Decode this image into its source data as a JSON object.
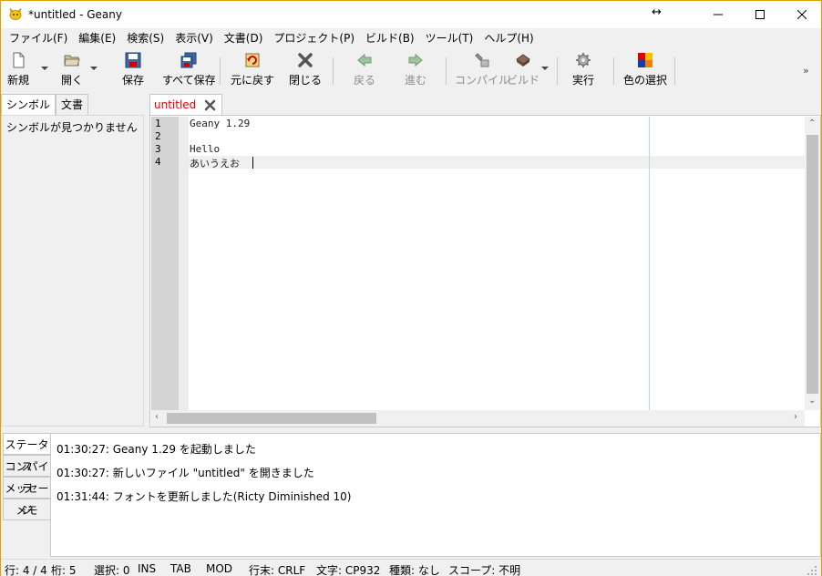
{
  "window": {
    "title": "*untitled - Geany",
    "resize_hint": "↔"
  },
  "menu": [
    {
      "label": "ファイル(F)"
    },
    {
      "label": "編集(E)"
    },
    {
      "label": "検索(S)"
    },
    {
      "label": "表示(V)"
    },
    {
      "label": "文書(D)"
    },
    {
      "label": "プロジェクト(P)"
    },
    {
      "label": "ビルド(B)"
    },
    {
      "label": "ツール(T)"
    },
    {
      "label": "ヘルプ(H)"
    }
  ],
  "toolbar": {
    "new_label": "新規",
    "open_label": "開く",
    "save_label": "保存",
    "save_all_label": "すべて保存",
    "revert_label": "元に戻す",
    "close_label": "閉じる",
    "back_label": "戻る",
    "forward_label": "進む",
    "compile_label": "コンパイル",
    "build_label": "ビルド",
    "run_label": "実行",
    "color_label": "色の選択",
    "more_label": "»"
  },
  "sidebar": {
    "tabs": [
      {
        "label": "シンボル"
      },
      {
        "label": "文書"
      }
    ],
    "empty_message": "シンボルが見つかりません"
  },
  "document_tab": {
    "label": "untitled"
  },
  "editor": {
    "lines": [
      {
        "number": "1",
        "text": "Geany 1.29"
      },
      {
        "number": "2",
        "text": ""
      },
      {
        "number": "3",
        "text": "Hello"
      },
      {
        "number": "4",
        "text": "あいうえお"
      }
    ]
  },
  "message_window": {
    "tabs": [
      {
        "label": "ステータス"
      },
      {
        "label": "コンパイラ"
      },
      {
        "label": "メッセージ"
      },
      {
        "label": "メモ"
      }
    ],
    "messages": [
      "01:30:27: Geany 1.29 を起動しました",
      "01:30:27: 新しいファイル \"untitled\" を開きました",
      "01:31:44: フォントを更新しました(Ricty Diminished 10)"
    ]
  },
  "statusbar": {
    "line": "行: 4 / 4",
    "col": "桁: 5",
    "sel": "選択: 0",
    "ins": "INS",
    "tab": "TAB",
    "mod": "MOD",
    "eol": "行末: CRLF",
    "enc": "文字: CP932",
    "type": "種類: なし",
    "scope": "スコープ: 不明"
  },
  "colors": {
    "tab_label": "#e00000",
    "long_line_marker": "#b8e0b8",
    "frame": "#e0a000"
  }
}
